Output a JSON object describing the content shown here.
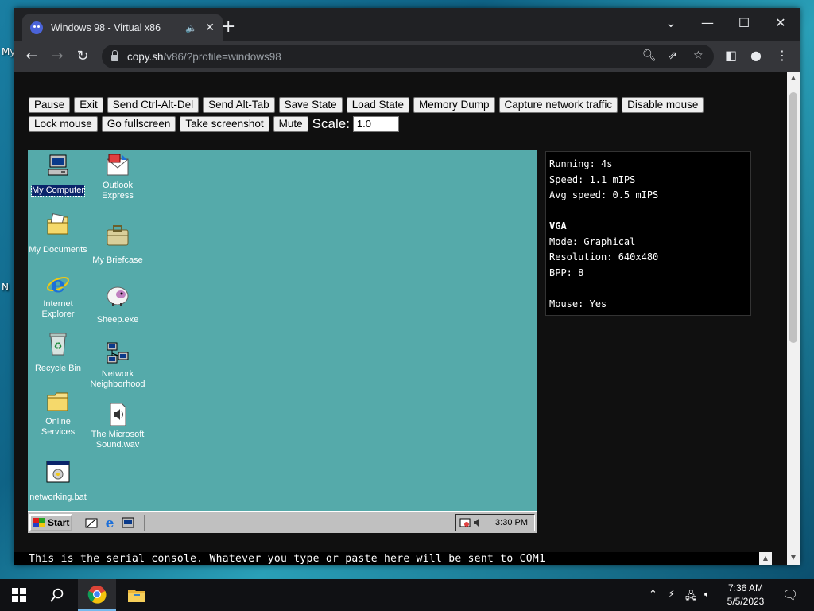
{
  "host_desktop": {
    "labels": [
      "My",
      "N"
    ]
  },
  "browser": {
    "tab": {
      "title": "Windows 98 - Virtual x86",
      "audio_icon": "speaker-icon",
      "close_icon": "close-icon"
    },
    "new_tab_icon": "plus-icon",
    "window_controls": [
      "chevron-down-icon",
      "minimize-icon",
      "maximize-icon",
      "close-icon"
    ],
    "url": {
      "host": "copy.sh",
      "path": "/v86/?profile=windows98"
    }
  },
  "emulator": {
    "buttons_row1": [
      "Pause",
      "Exit",
      "Send Ctrl-Alt-Del",
      "Send Alt-Tab",
      "Save State",
      "Load State",
      "Memory Dump",
      "Capture network traffic",
      "Disable mouse"
    ],
    "buttons_row2": [
      "Lock mouse",
      "Go fullscreen",
      "Take screenshot",
      "Mute"
    ],
    "scale_label": "Scale:",
    "scale_value": "1.0"
  },
  "win98": {
    "icons": [
      {
        "label": "My Computer",
        "icon": "computer-icon"
      },
      {
        "label": "Outlook Express",
        "icon": "mail-icon"
      },
      {
        "label": "My Documents",
        "icon": "documents-folder-icon"
      },
      {
        "label": "My Briefcase",
        "icon": "briefcase-icon"
      },
      {
        "label": "Internet Explorer",
        "icon": "ie-icon"
      },
      {
        "label": "Sheep.exe",
        "icon": "sheep-icon"
      },
      {
        "label": "Recycle Bin",
        "icon": "recycle-bin-icon"
      },
      {
        "label": "Network Neighborhood",
        "icon": "network-icon"
      },
      {
        "label": "Online Services",
        "icon": "folder-icon"
      },
      {
        "label": "The Microsoft Sound.wav",
        "icon": "sound-file-icon"
      },
      {
        "label": "networking.bat",
        "icon": "batch-file-icon"
      }
    ],
    "taskbar": {
      "start_label": "Start",
      "clock": "3:30 PM"
    }
  },
  "stats": {
    "running": "Running: 4s",
    "speed": "Speed: 1.1 mIPS",
    "avg_speed": "Avg speed: 0.5 mIPS",
    "vga_heading": "VGA",
    "mode": "Mode: Graphical",
    "resolution": "Resolution: 640x480",
    "bpp": "BPP: 8",
    "mouse": "Mouse: Yes"
  },
  "serial_console": "This is the serial console. Whatever you type or paste here will be sent to COM1",
  "os_taskbar": {
    "clock_time": "7:36 AM",
    "clock_date": "5/5/2023"
  }
}
